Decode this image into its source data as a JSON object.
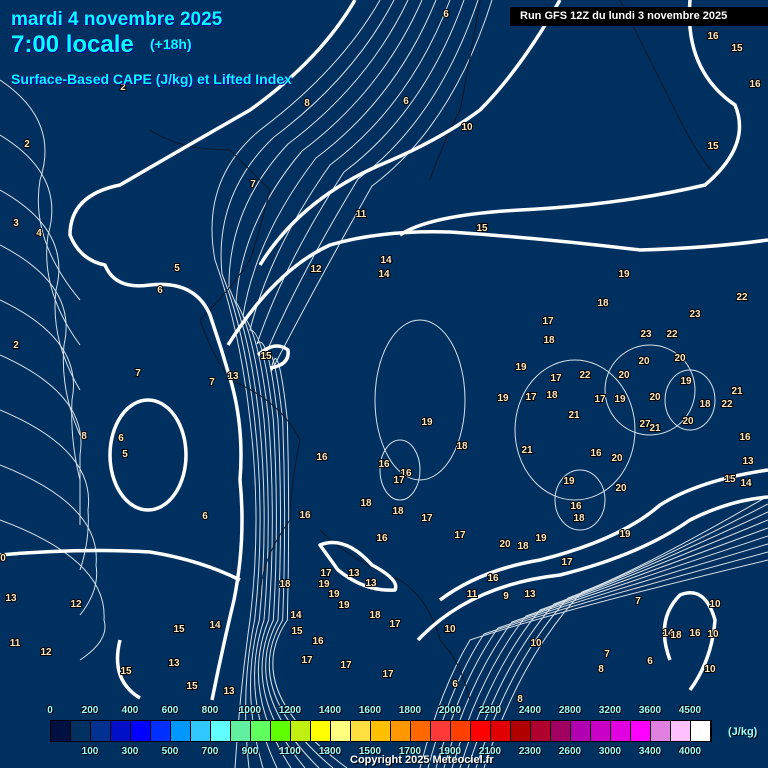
{
  "header": {
    "date": "mardi 4 novembre 2025",
    "time": "7:00 locale",
    "lead": "(+18h)",
    "parameter": "Surface-Based CAPE (J/kg) et Lifted Index",
    "run": "Run GFS 12Z du lundi 3 novembre 2025"
  },
  "legend": {
    "unit": "(J/kg)",
    "top_labels": [
      "0",
      "200",
      "400",
      "600",
      "800",
      "1000",
      "1200",
      "1400",
      "1600",
      "1800",
      "2000",
      "2200",
      "2400",
      "2800",
      "3200",
      "3600",
      "4500"
    ],
    "bottom_labels": [
      "100",
      "300",
      "500",
      "700",
      "900",
      "1100",
      "1300",
      "1500",
      "1700",
      "1900",
      "2100",
      "2300",
      "2600",
      "3000",
      "3400",
      "4000"
    ],
    "colors": [
      "#001040",
      "#003060",
      "#003090",
      "#0010c8",
      "#0000ff",
      "#0030ff",
      "#0098ff",
      "#30c8ff",
      "#60ffff",
      "#60f0a0",
      "#60ff60",
      "#60ff00",
      "#c0f010",
      "#ffff00",
      "#ffff80",
      "#ffe040",
      "#ffc000",
      "#ff9800",
      "#ff6800",
      "#ff3838",
      "#ff4000",
      "#ff0000",
      "#e00000",
      "#b00000",
      "#b00030",
      "#a00060",
      "#b000b0",
      "#c800c8",
      "#e000e0",
      "#ff00ff",
      "#e080e0",
      "#ffc0ff",
      "#ffffff"
    ]
  },
  "copyright": "Copyright 2025 Meteociel.fr",
  "contour_labels": [
    "6",
    "16",
    "15",
    "16",
    "2",
    "8",
    "6",
    "10",
    "15",
    "2",
    "7",
    "11",
    "15",
    "4",
    "3",
    "5",
    "12",
    "14",
    "14",
    "19",
    "18",
    "22",
    "6",
    "17",
    "18",
    "23",
    "22",
    "23",
    "2",
    "15",
    "19",
    "17",
    "22",
    "20",
    "20",
    "20",
    "7",
    "7",
    "13",
    "18",
    "19",
    "17",
    "19",
    "21",
    "8",
    "6",
    "5",
    "19",
    "21",
    "20",
    "17",
    "19",
    "18",
    "22",
    "20",
    "27",
    "21",
    "16",
    "18",
    "21",
    "16",
    "20",
    "13",
    "16",
    "16",
    "16",
    "17",
    "19",
    "15",
    "14",
    "20",
    "6",
    "16",
    "18",
    "18",
    "17",
    "16",
    "18",
    "19",
    "17",
    "16",
    "20",
    "18",
    "19",
    "17",
    "0",
    "18",
    "17",
    "19",
    "13",
    "13",
    "16",
    "13",
    "12",
    "19",
    "19",
    "11",
    "9",
    "13",
    "18",
    "14",
    "7",
    "10",
    "14",
    "15",
    "15",
    "17",
    "10",
    "16",
    "11",
    "10",
    "14",
    "16",
    "18",
    "10",
    "12",
    "7",
    "6",
    "17",
    "17",
    "13",
    "17",
    "15",
    "8",
    "10",
    "15",
    "13",
    "6",
    "8"
  ],
  "colors": {
    "background": "#003060",
    "title": "#00ffff",
    "contour": "#ffffff"
  }
}
